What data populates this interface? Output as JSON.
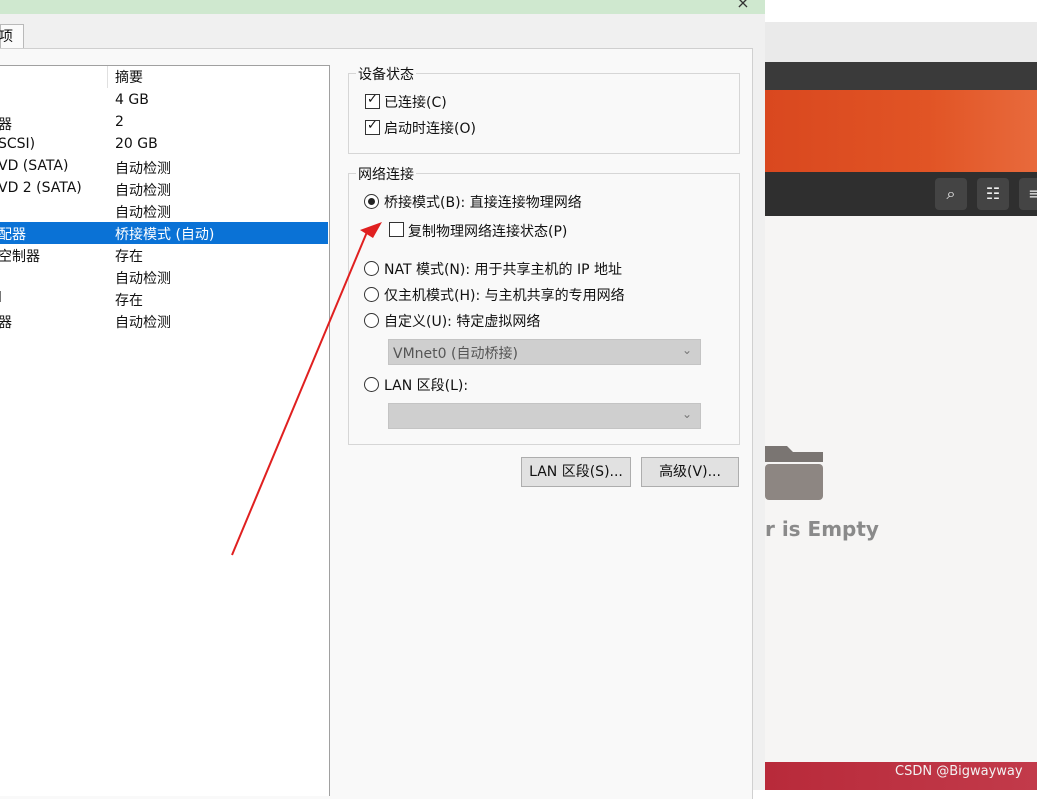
{
  "tab": {
    "label": "项"
  },
  "device_list": {
    "header_summary": "摘要",
    "rows": [
      {
        "device": "",
        "summary": "4 GB",
        "selected": false
      },
      {
        "device": "器",
        "summary": "2",
        "selected": false
      },
      {
        "device": "SCSI)",
        "summary": "20 GB",
        "selected": false
      },
      {
        "device": "VD (SATA)",
        "summary": "自动检测",
        "selected": false
      },
      {
        "device": "VD 2 (SATA)",
        "summary": "自动检测",
        "selected": false
      },
      {
        "device": "",
        "summary": "自动检测",
        "selected": false
      },
      {
        "device": "配器",
        "summary": "桥接模式 (自动)",
        "selected": true
      },
      {
        "device": "空制器",
        "summary": "存在",
        "selected": false
      },
      {
        "device": "",
        "summary": "自动检测",
        "selected": false
      },
      {
        "device": "l",
        "summary": "存在",
        "selected": false
      },
      {
        "device": "器",
        "summary": "自动检测",
        "selected": false
      }
    ]
  },
  "device_status": {
    "title": "设备状态",
    "connected_label": "已连接(C)",
    "connected_checked": true,
    "connect_on_start_label": "启动时连接(O)",
    "connect_on_start_checked": true
  },
  "network": {
    "title": "网络连接",
    "bridged_label": "桥接模式(B): 直接连接物理网络",
    "replicate_label": "复制物理网络连接状态(P)",
    "nat_label": "NAT 模式(N): 用于共享主机的 IP 地址",
    "hostonly_label": "仅主机模式(H): 与主机共享的专用网络",
    "custom_label": "自定义(U): 特定虚拟网络",
    "custom_select_value": "VMnet0 (自动桥接)",
    "lan_label": "LAN 区段(L):",
    "lan_select_value": "",
    "selected_mode": "bridged"
  },
  "buttons": {
    "lan_segments": "LAN 区段(S)...",
    "advanced": "高级(V)..."
  },
  "background_app": {
    "empty_text": "r is Empty",
    "watermark": "CSDN @Bigwayway"
  },
  "colors": {
    "selection": "#0a72d6",
    "arrow": "#e02020",
    "titlebar": "#cfe8cf"
  }
}
